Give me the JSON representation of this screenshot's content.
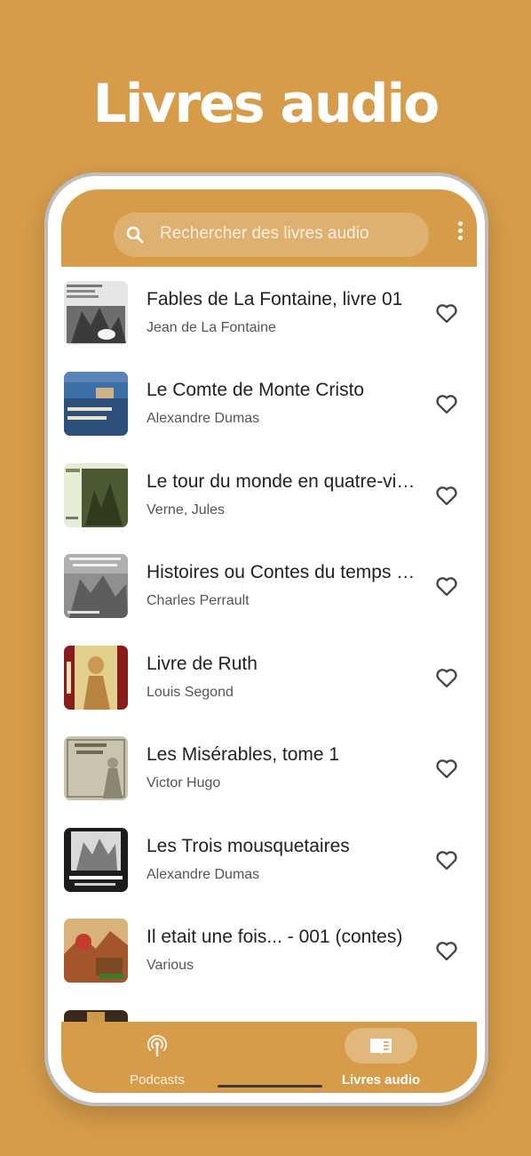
{
  "hero": {
    "title": "Livres audio"
  },
  "search": {
    "placeholder": "Rechercher des livres audio",
    "icon": "search-icon"
  },
  "menu": {
    "icon": "more-vert-icon"
  },
  "books": [
    {
      "title": "Fables de La Fontaine, livre 01",
      "author": "Jean de La Fontaine",
      "favorite": false
    },
    {
      "title": "Le Comte de Monte Cristo",
      "author": "Alexandre Dumas",
      "favorite": false
    },
    {
      "title": "Le tour du monde en quatre-vingts jours",
      "author": "Verne, Jules",
      "favorite": false
    },
    {
      "title": "Histoires ou Contes du temps passé",
      "author": "Charles Perrault",
      "favorite": false
    },
    {
      "title": "Livre de Ruth",
      "author": "Louis Segond",
      "favorite": false
    },
    {
      "title": "Les Misérables, tome 1",
      "author": "Victor Hugo",
      "favorite": false
    },
    {
      "title": "Les Trois mousquetaires",
      "author": "Alexandre Dumas",
      "favorite": false
    },
    {
      "title": "Il etait une fois... - 001 (contes)",
      "author": "Various",
      "favorite": false
    }
  ],
  "nav": {
    "podcasts_label": "Podcasts",
    "audiobooks_label": "Livres audio",
    "active": "audiobooks"
  },
  "colors": {
    "accent": "#D69C4A",
    "text": "#222222",
    "subtext": "#555555"
  }
}
